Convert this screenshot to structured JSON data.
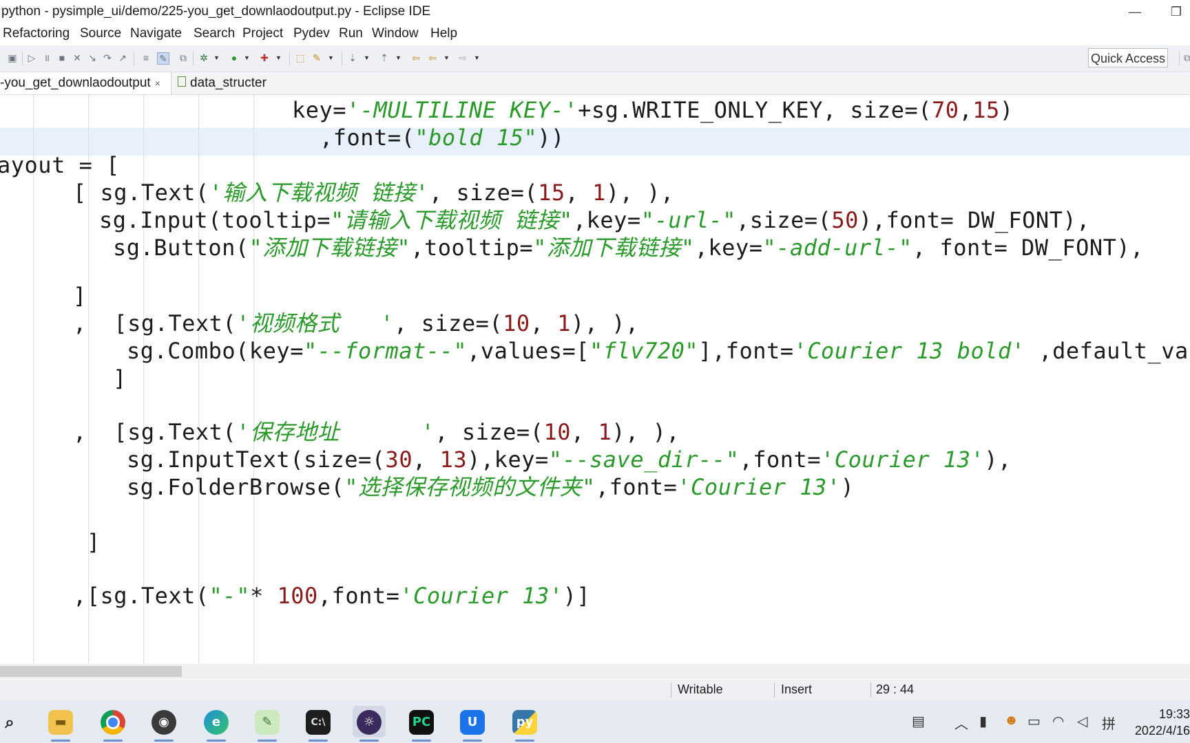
{
  "window": {
    "title": "python - pysimple_ui/demo/225-you_get_downlaodoutput.py - Eclipse IDE",
    "minimize_glyph": "—",
    "restore_glyph": "❐"
  },
  "menu": [
    "Refactoring",
    "Source",
    "Navigate",
    "Search",
    "Project",
    "Pydev",
    "Run",
    "Window",
    "Help"
  ],
  "toolbar": {
    "quick_access": "Quick Access"
  },
  "tabs": [
    {
      "label": "-you_get_downlaodoutput",
      "active": true,
      "close": "×"
    },
    {
      "label": "data_structer",
      "active": false
    }
  ],
  "editor": {
    "lines": [
      [
        {
          "t": "key=",
          "c": ""
        },
        {
          "t": "'-MULTILINE KEY-'",
          "c": "s"
        },
        {
          "t": "+sg.WRITE_ONLY_KEY, size=(",
          "c": ""
        },
        {
          "t": "70",
          "c": "n"
        },
        {
          "t": ",",
          "c": ""
        },
        {
          "t": "15",
          "c": "n"
        },
        {
          "t": ")",
          "c": ""
        }
      ],
      [
        {
          "t": ",font=(",
          "c": ""
        },
        {
          "t": "\"bold 15\"",
          "c": "s"
        },
        {
          "t": "))",
          "c": ""
        }
      ],
      [
        {
          "t": "ayout = [",
          "c": ""
        }
      ],
      [
        {
          "t": "[ sg.Text(",
          "c": ""
        },
        {
          "t": "'输入下载视频 链接'",
          "c": "s"
        },
        {
          "t": ", size=(",
          "c": ""
        },
        {
          "t": "15",
          "c": "n"
        },
        {
          "t": ", ",
          "c": ""
        },
        {
          "t": "1",
          "c": "n"
        },
        {
          "t": "), ),",
          "c": ""
        }
      ],
      [
        {
          "t": "sg.Input(tooltip=",
          "c": ""
        },
        {
          "t": "\"请输入下载视频 链接\"",
          "c": "s"
        },
        {
          "t": ",key=",
          "c": ""
        },
        {
          "t": "\"-url-\"",
          "c": "s"
        },
        {
          "t": ",size=(",
          "c": ""
        },
        {
          "t": "50",
          "c": "n"
        },
        {
          "t": "),font= DW_FONT),",
          "c": ""
        }
      ],
      [
        {
          "t": "sg.Button(",
          "c": ""
        },
        {
          "t": "\"添加下载链接\"",
          "c": "s"
        },
        {
          "t": ",tooltip=",
          "c": ""
        },
        {
          "t": "\"添加下载链接\"",
          "c": "s"
        },
        {
          "t": ",key=",
          "c": ""
        },
        {
          "t": "\"-add-url-\"",
          "c": "s"
        },
        {
          "t": ", font= DW_FONT),",
          "c": ""
        }
      ],
      [
        {
          "t": "]",
          "c": ""
        }
      ],
      [
        {
          "t": ",  [sg.Text(",
          "c": ""
        },
        {
          "t": "'视频格式   '",
          "c": "s"
        },
        {
          "t": ", size=(",
          "c": ""
        },
        {
          "t": "10",
          "c": "n"
        },
        {
          "t": ", ",
          "c": ""
        },
        {
          "t": "1",
          "c": "n"
        },
        {
          "t": "), ),",
          "c": ""
        }
      ],
      [
        {
          "t": "sg.Combo(key=",
          "c": ""
        },
        {
          "t": "\"--format--\"",
          "c": "s"
        },
        {
          "t": ",values=[",
          "c": ""
        },
        {
          "t": "\"flv720\"",
          "c": "s"
        },
        {
          "t": "],font=",
          "c": ""
        },
        {
          "t": "'Courier 13 bold'",
          "c": "s"
        },
        {
          "t": " ,default_va",
          "c": ""
        }
      ],
      [
        {
          "t": "]",
          "c": ""
        }
      ],
      [
        {
          "t": ",  [sg.Text(",
          "c": ""
        },
        {
          "t": "'保存地址      '",
          "c": "s"
        },
        {
          "t": ", size=(",
          "c": ""
        },
        {
          "t": "10",
          "c": "n"
        },
        {
          "t": ", ",
          "c": ""
        },
        {
          "t": "1",
          "c": "n"
        },
        {
          "t": "), ),",
          "c": ""
        }
      ],
      [
        {
          "t": "sg.InputText(size=(",
          "c": ""
        },
        {
          "t": "30",
          "c": "n"
        },
        {
          "t": ", ",
          "c": ""
        },
        {
          "t": "13",
          "c": "n"
        },
        {
          "t": "),key=",
          "c": ""
        },
        {
          "t": "\"--save_dir--\"",
          "c": "s"
        },
        {
          "t": ",font=",
          "c": ""
        },
        {
          "t": "'Courier 13'",
          "c": "s"
        },
        {
          "t": "),",
          "c": ""
        }
      ],
      [
        {
          "t": "sg.FolderBrowse(",
          "c": ""
        },
        {
          "t": "\"选择保存视频的文件夹\"",
          "c": "s"
        },
        {
          "t": ",font=",
          "c": ""
        },
        {
          "t": "'Courier 13'",
          "c": "s"
        },
        {
          "t": ")",
          "c": ""
        }
      ],
      [
        {
          "t": "]",
          "c": ""
        }
      ],
      [
        {
          "t": ",[sg.Text(",
          "c": ""
        },
        {
          "t": "\"-\"",
          "c": "s"
        },
        {
          "t": "* ",
          "c": ""
        },
        {
          "t": "100",
          "c": "n"
        },
        {
          "t": ",font=",
          "c": ""
        },
        {
          "t": "'Courier 13'",
          "c": "s"
        },
        {
          "t": ")]",
          "c": ""
        }
      ]
    ]
  },
  "status": {
    "writable": "Writable",
    "insert": "Insert",
    "position": "29 : 44"
  },
  "taskbar": {
    "apps": [
      "search-icon",
      "file-explorer-icon",
      "chrome-icon",
      "obs-icon",
      "edge-icon",
      "notepad-icon",
      "terminal-icon",
      "eclipse-icon",
      "pycharm-icon",
      "app-icon",
      "python-icon"
    ],
    "time": "19:33",
    "date": "2022/4/16"
  },
  "colors": {
    "string": "#2a9a2a",
    "number": "#8a1a1a",
    "current_line": "#e8f0fb"
  }
}
